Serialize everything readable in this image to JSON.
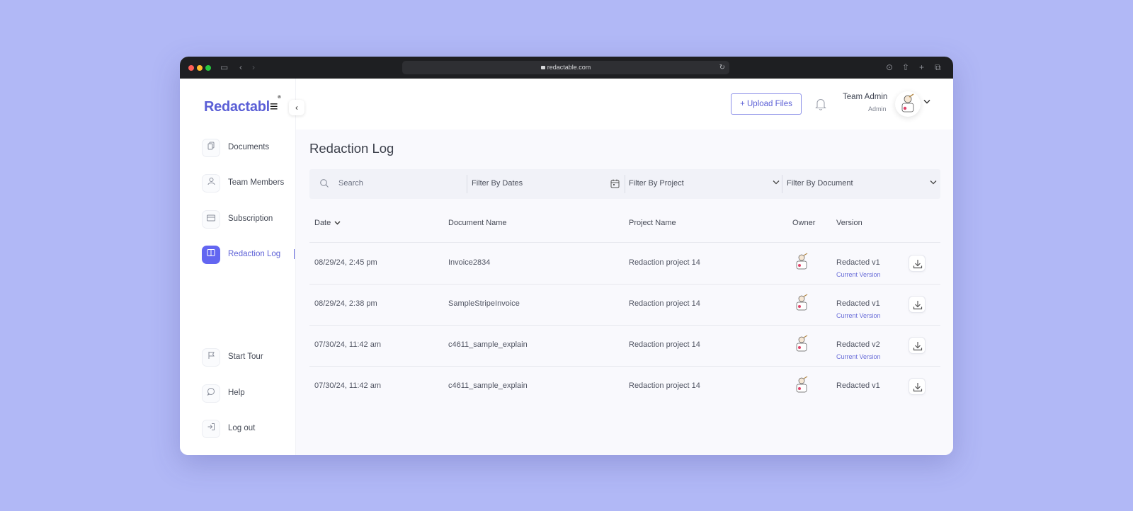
{
  "browser": {
    "url": "redactable.com"
  },
  "brand": {
    "logo_text": "Redactabl",
    "logo_mark": "≡",
    "logo_sup": "®"
  },
  "sidebar": {
    "items": [
      {
        "label": "Documents",
        "icon": "documents-icon"
      },
      {
        "label": "Team Members",
        "icon": "user-icon"
      },
      {
        "label": "Subscription",
        "icon": "card-icon"
      },
      {
        "label": "Redaction Log",
        "icon": "book-icon",
        "active": true
      }
    ],
    "bottom_items": [
      {
        "label": "Start Tour",
        "icon": "flag-icon"
      },
      {
        "label": "Help",
        "icon": "chat-icon"
      },
      {
        "label": "Log out",
        "icon": "logout-icon"
      }
    ]
  },
  "header": {
    "upload_label": "+ Upload Files",
    "user_name": "Team Admin",
    "user_role": "Admin"
  },
  "page": {
    "title": "Redaction Log"
  },
  "filters": {
    "search_placeholder": "Search",
    "dates_label": "Filter By Dates",
    "project_label": "Filter By Project",
    "document_label": "Filter By Document"
  },
  "table": {
    "columns": [
      "Date",
      "Document Name",
      "Project Name",
      "Owner",
      "Version"
    ],
    "rows": [
      {
        "date": "08/29/24, 2:45 pm",
        "document": "Invoice2834",
        "project": "Redaction project 14",
        "version": "Redacted v1",
        "current": "Current Version"
      },
      {
        "date": "08/29/24, 2:38 pm",
        "document": "SampleStripeInvoice",
        "project": "Redaction project 14",
        "version": "Redacted v1",
        "current": "Current Version"
      },
      {
        "date": "07/30/24, 11:42 am",
        "document": "c4611_sample_explain",
        "project": "Redaction project 14",
        "version": "Redacted v2",
        "current": "Current Version"
      },
      {
        "date": "07/30/24, 11:42 am",
        "document": "c4611_sample_explain",
        "project": "Redaction project 14",
        "version": "Redacted v1",
        "current": ""
      }
    ]
  },
  "colors": {
    "accent": "#6366f1",
    "background": "#b1b8f6"
  }
}
